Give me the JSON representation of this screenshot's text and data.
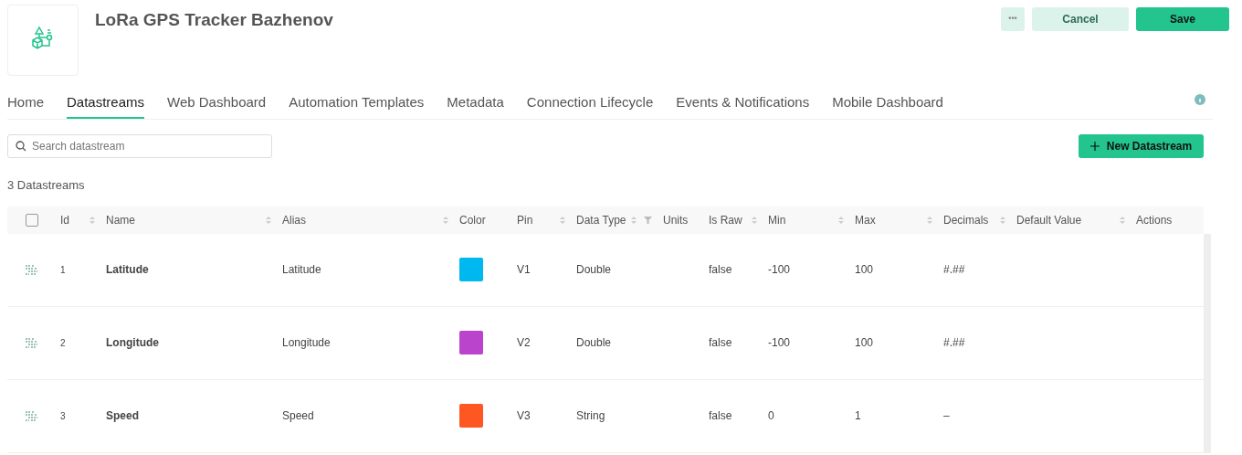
{
  "product": {
    "title": "LoRa GPS Tracker Bazhenov"
  },
  "header_buttons": [
    {
      "kind": "more",
      "label": "•••"
    },
    {
      "kind": "secondary",
      "label": "Cancel"
    },
    {
      "kind": "primary",
      "label": "Save"
    }
  ],
  "tabs": [
    {
      "label": "Home",
      "selected": false
    },
    {
      "label": "Datastreams",
      "selected": true
    },
    {
      "label": "Web Dashboard",
      "selected": false
    },
    {
      "label": "Automation Templates",
      "selected": false
    },
    {
      "label": "Metadata",
      "selected": false
    },
    {
      "label": "Connection Lifecycle",
      "selected": false
    },
    {
      "label": "Events & Notifications",
      "selected": false
    },
    {
      "label": "Mobile Dashboard",
      "selected": false
    }
  ],
  "search": {
    "placeholder": "Search datastream"
  },
  "new_button": {
    "label": "New Datastream"
  },
  "count": "3 Datastreams",
  "table": {
    "select_all": {
      "checked": false
    },
    "columns": [
      {
        "label": "Id",
        "sortable": true,
        "filter": false
      },
      {
        "label": "Name",
        "sortable": true,
        "filter": false
      },
      {
        "label": "Alias",
        "sortable": true,
        "filter": false
      },
      {
        "label": "Color",
        "sortable": false,
        "filter": false
      },
      {
        "label": "Pin",
        "sortable": true,
        "filter": false
      },
      {
        "label": "Data Type",
        "sortable": true,
        "filter": true
      },
      {
        "label": "Units",
        "sortable": false,
        "filter": false
      },
      {
        "label": "Is Raw",
        "sortable": true,
        "filter": false
      },
      {
        "label": "Min",
        "sortable": true,
        "filter": false
      },
      {
        "label": "Max",
        "sortable": true,
        "filter": false
      },
      {
        "label": "Decimals",
        "sortable": true,
        "filter": false
      },
      {
        "label": "Default Value",
        "sortable": true,
        "filter": false
      },
      {
        "label": "Actions",
        "sortable": false,
        "filter": false
      }
    ],
    "rows": [
      {
        "id": "1",
        "name": "Latitude",
        "alias": "Latitude",
        "color": "#00b8f0",
        "pin": "V1",
        "data_type": "Double",
        "is_raw": "false",
        "min": "-100",
        "max": "100",
        "decimals": "#.##"
      },
      {
        "id": "2",
        "name": "Longitude",
        "alias": "Longitude",
        "color": "#bb44cc",
        "pin": "V2",
        "data_type": "Double",
        "is_raw": "false",
        "min": "-100",
        "max": "100",
        "decimals": "#.##"
      },
      {
        "id": "3",
        "name": "Speed",
        "alias": "Speed",
        "color": "#ff5722",
        "pin": "V3",
        "data_type": "String",
        "is_raw": "false",
        "min": "0",
        "max": "1",
        "decimals": "–"
      }
    ]
  }
}
